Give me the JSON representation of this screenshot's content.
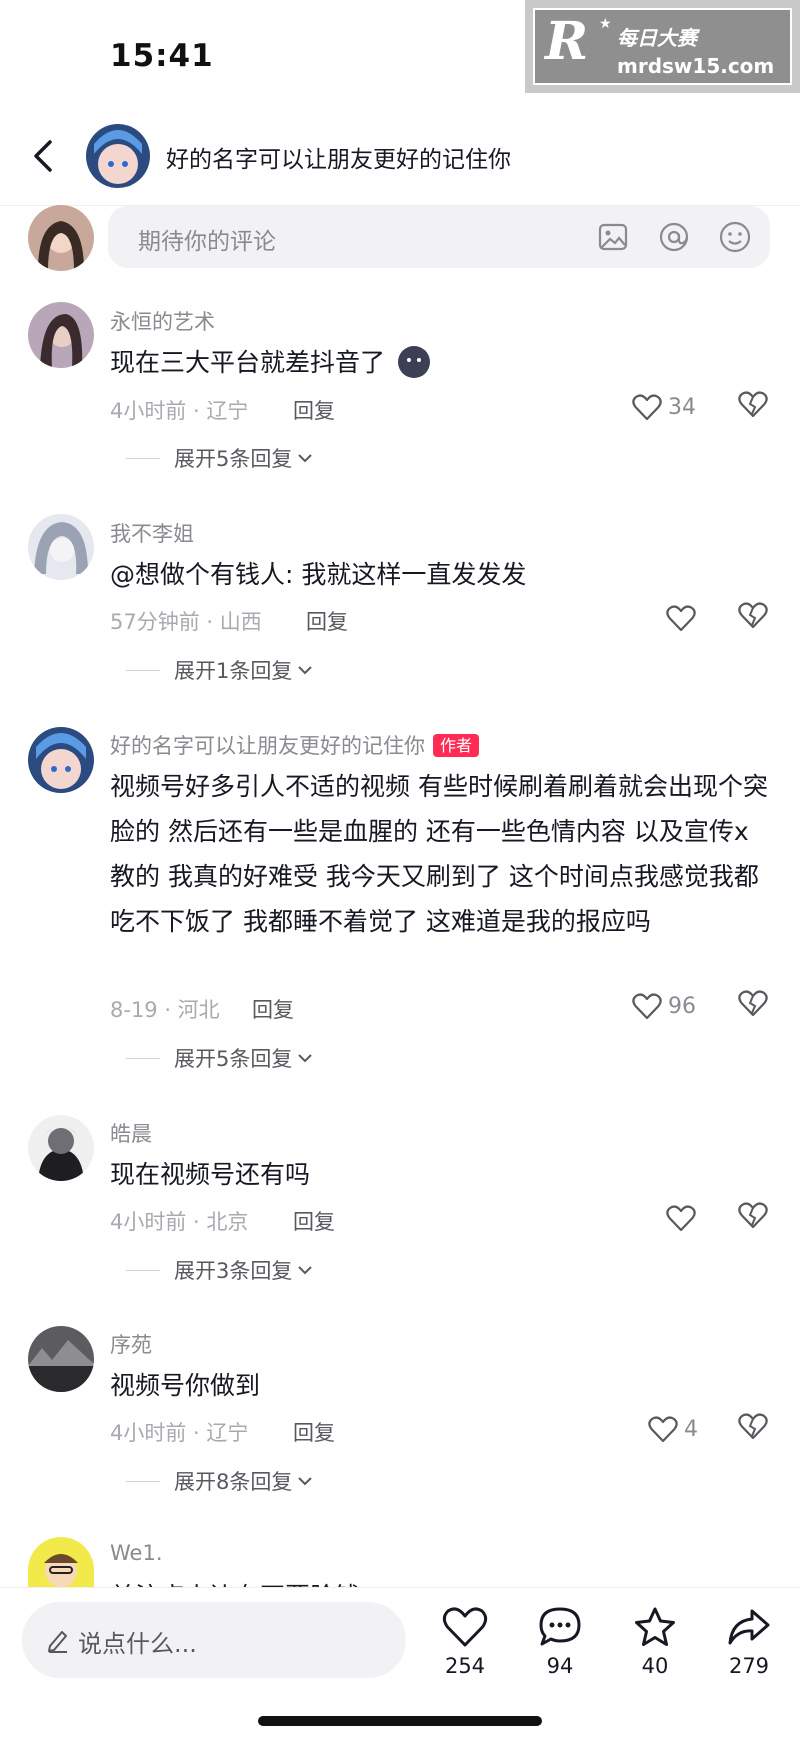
{
  "status_bar": {
    "time": "15:41"
  },
  "watermark": {
    "logo_letter": "R",
    "title": "每日大赛",
    "url": "mrdsw15.com"
  },
  "header": {
    "title": "好的名字可以让朋友更好的记住你"
  },
  "comment_input": {
    "placeholder": "期待你的评论",
    "icons": [
      "image-icon",
      "at-icon",
      "emoji-icon"
    ]
  },
  "comments": [
    {
      "username": "永恒的艺术",
      "text": "现在三大平台就差抖音了",
      "meta": "4小时前 · 辽宁",
      "reply": "回复",
      "likes": "34",
      "expand": "展开5条回复",
      "has_emoji": true
    },
    {
      "username": "我不李姐",
      "text": "@想做个有钱人: 我就这样一直发发发",
      "meta": "57分钟前 · 山西",
      "reply": "回复",
      "likes": "",
      "expand": "展开1条回复"
    },
    {
      "username": "好的名字可以让朋友更好的记住你",
      "badge": "作者",
      "text": "视频号好多引人不适的视频 有些时候刷着刷着就会出现个突脸的 然后还有一些是血腥的 还有一些色情内容 以及宣传x教的 我真的好难受 我今天又刷到了 这个时间点我感觉我都吃不下饭了 我都睡不着觉了 这难道是我的报应吗",
      "meta": "8-19 · 河北",
      "reply": "回复",
      "likes": "96",
      "expand": "展开5条回复"
    },
    {
      "username": "皓晨",
      "text": "现在视频号还有吗",
      "meta": "4小时前 · 北京",
      "reply": "回复",
      "likes": "",
      "expand": "展开3条回复"
    },
    {
      "username": "序苑",
      "text": "视频号你做到",
      "meta": "4小时前 · 辽宁",
      "reply": "回复",
      "likes": "4",
      "expand": "展开8条回复"
    },
    {
      "username": "We1.",
      "text": "关注点上边有不要脸钱"
    }
  ],
  "bottom_bar": {
    "placeholder": "说点什么...",
    "like_count": "254",
    "comment_count": "94",
    "favorite_count": "40",
    "share_count": "279"
  },
  "colors": {
    "accent": "#fe2c55",
    "text_primary": "#161823",
    "text_secondary": "#8a8b91"
  }
}
